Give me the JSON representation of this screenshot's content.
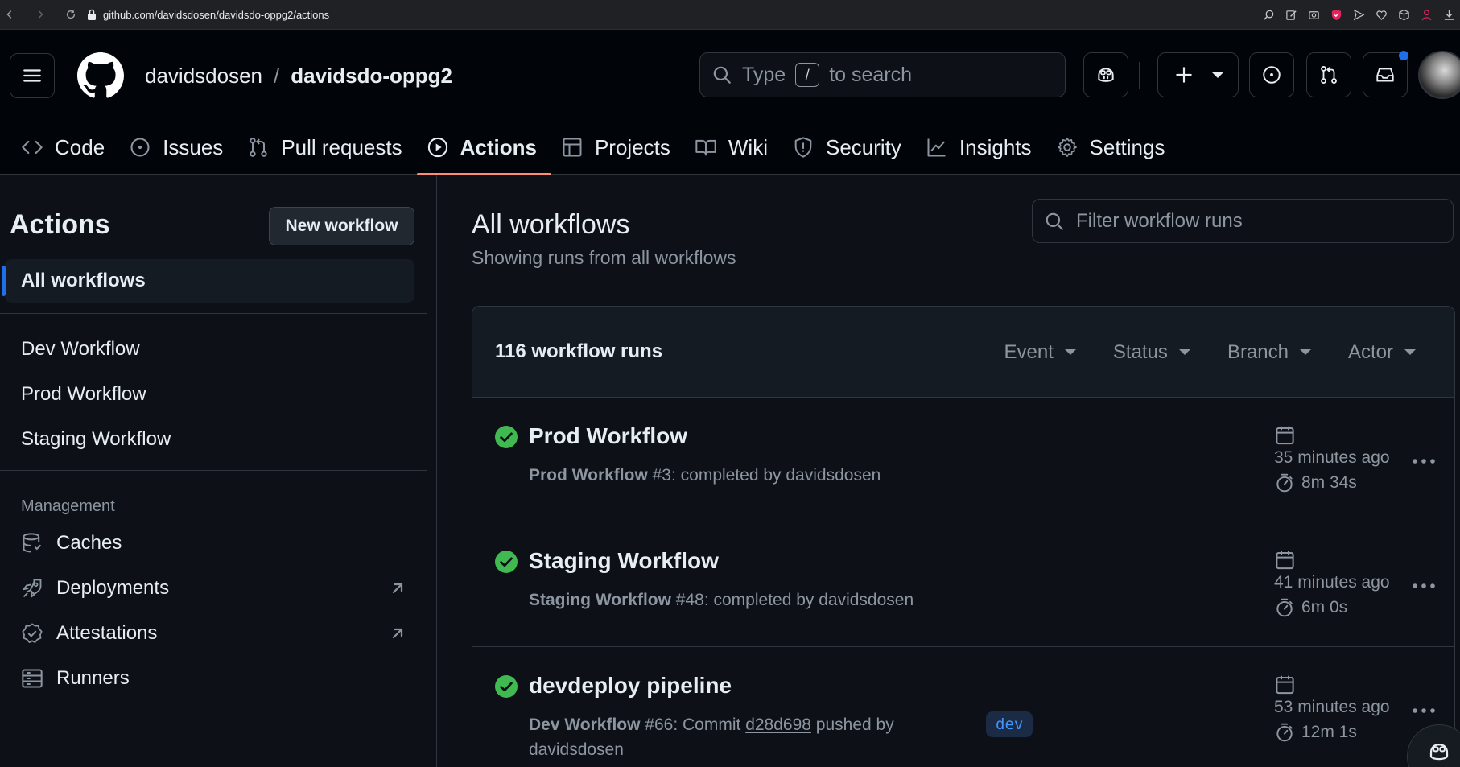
{
  "browser": {
    "url": "github.com/davidsdosen/davidsdo-oppg2/actions"
  },
  "header": {
    "owner": "davidsdosen",
    "separator": "/",
    "repo": "davidsdo-oppg2",
    "search_prefix": "Type",
    "search_key": "/",
    "search_suffix": "to search"
  },
  "tabs": [
    {
      "label": "Code",
      "icon": "code-icon"
    },
    {
      "label": "Issues",
      "icon": "issue-icon"
    },
    {
      "label": "Pull requests",
      "icon": "pull-request-icon"
    },
    {
      "label": "Actions",
      "icon": "play-icon",
      "active": true
    },
    {
      "label": "Projects",
      "icon": "table-icon"
    },
    {
      "label": "Wiki",
      "icon": "book-icon"
    },
    {
      "label": "Security",
      "icon": "shield-icon"
    },
    {
      "label": "Insights",
      "icon": "graph-icon"
    },
    {
      "label": "Settings",
      "icon": "gear-icon"
    }
  ],
  "sidebar": {
    "title": "Actions",
    "new_workflow": "New workflow",
    "all_workflows": "All workflows",
    "workflows": [
      "Dev Workflow",
      "Prod Workflow",
      "Staging Workflow"
    ],
    "management_heading": "Management",
    "management": [
      {
        "label": "Caches",
        "icon": "database-icon"
      },
      {
        "label": "Deployments",
        "icon": "rocket-icon",
        "external": true
      },
      {
        "label": "Attestations",
        "icon": "verified-icon",
        "external": true
      },
      {
        "label": "Runners",
        "icon": "server-icon"
      }
    ]
  },
  "main": {
    "title": "All workflows",
    "subtitle": "Showing runs from all workflows",
    "filter_placeholder": "Filter workflow runs",
    "runs_count": "116 workflow runs",
    "filters": [
      "Event",
      "Status",
      "Branch",
      "Actor"
    ],
    "status_color": "#3fb950",
    "runs": [
      {
        "title": "Prod Workflow",
        "workflow": "Prod Workflow",
        "detail": " #3: completed by davidsdosen",
        "ago": "35 minutes ago",
        "duration": "8m 34s"
      },
      {
        "title": "Staging Workflow",
        "workflow": "Staging Workflow",
        "detail": " #48: completed by davidsdosen",
        "ago": "41 minutes ago",
        "duration": "6m 0s"
      },
      {
        "title": "devdeploy pipeline",
        "workflow": "Dev Workflow",
        "detail_pre": " #66: Commit ",
        "commit": "d28d698",
        "detail_post": " pushed by",
        "detail_line2": "davidsdosen",
        "branch": "dev",
        "ago": "53 minutes ago",
        "duration": "12m 1s"
      }
    ]
  }
}
